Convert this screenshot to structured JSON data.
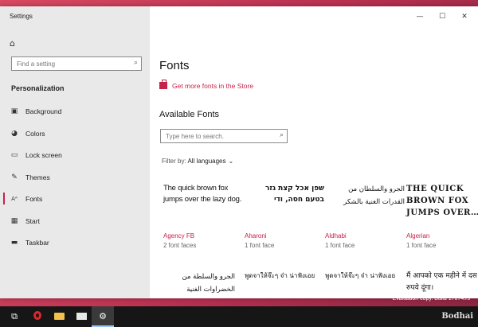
{
  "window": {
    "title": "Settings",
    "controls": {
      "minimize": "—",
      "maximize": "☐",
      "close": "✕"
    }
  },
  "sidebar": {
    "home_icon": "home-icon",
    "search_placeholder": "Find a setting",
    "section_title": "Personalization",
    "items": [
      {
        "label": "Background",
        "icon": "image-icon",
        "glyph": "▣"
      },
      {
        "label": "Colors",
        "icon": "palette-icon",
        "glyph": "◕"
      },
      {
        "label": "Lock screen",
        "icon": "lock-screen-icon",
        "glyph": "▭"
      },
      {
        "label": "Themes",
        "icon": "brush-icon",
        "glyph": "✎"
      },
      {
        "label": "Fonts",
        "icon": "font-icon",
        "glyph": "Aᴬ"
      },
      {
        "label": "Start",
        "icon": "start-icon",
        "glyph": "▦"
      },
      {
        "label": "Taskbar",
        "icon": "taskbar-icon",
        "glyph": "▬"
      }
    ],
    "active_item": "Fonts"
  },
  "main": {
    "title": "Fonts",
    "store_link": "Get more fonts in the Store",
    "available_title": "Available Fonts",
    "search_placeholder": "Type here to search.",
    "filter_label": "Filter by:",
    "filter_value": "All languages",
    "fonts": [
      {
        "sample": "The quick brown fox jumps over the lazy dog.",
        "name": "Agency FB",
        "faces": "2 font faces"
      },
      {
        "sample": "שפן אכל קצת גזר בטעם חסה, ודי",
        "name": "Aharoni",
        "faces": "1 font face"
      },
      {
        "sample": "الجرو والسلطان من القدرات الغنية بالشكر",
        "name": "Aldhabi",
        "faces": "1 font face"
      },
      {
        "sample": "THE QUICK BROWN FOX JUMPS OVER…",
        "name": "Algerian",
        "faces": "1 font face"
      },
      {
        "sample": "الجرو والسلطة من الخضراوات الغنية"
      },
      {
        "sample": "พูดจาให้จ๊ะๆ จ๋า น่าฟังเอย"
      },
      {
        "sample": "พูดจาให้จ๊ะๆ จ๋า น่าฟังเอย"
      },
      {
        "sample": "मैं आपको एक महीने में दस रुपये दूंगा।"
      }
    ]
  },
  "taskbar": {
    "items": [
      {
        "icon": "task-view-icon",
        "glyph": "⧉"
      },
      {
        "icon": "opera-icon"
      },
      {
        "icon": "file-explorer-icon"
      },
      {
        "icon": "mail-icon"
      },
      {
        "icon": "settings-gear-icon",
        "glyph": "⚙"
      }
    ]
  },
  "overlay": {
    "evaluation": "Evaluation copy. Build 17074.rs",
    "watermark": "Bodhai"
  },
  "colors": {
    "accent": "#c4234a",
    "sidebar_bg": "#e9e9e9",
    "taskbar_bg": "#161616"
  }
}
